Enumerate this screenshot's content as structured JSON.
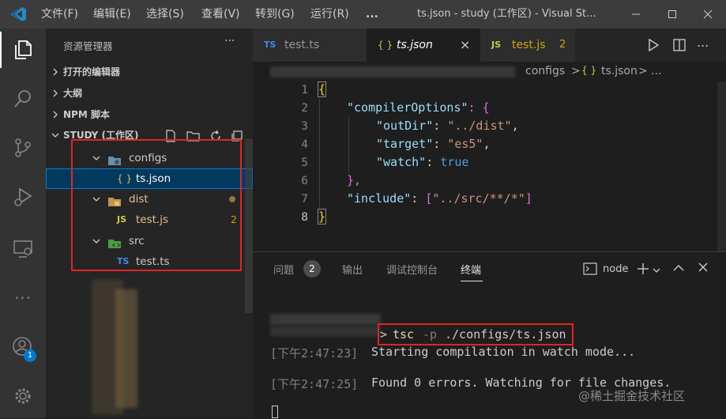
{
  "titlebar": {
    "menus": [
      "文件(F)",
      "编辑(E)",
      "选择(S)",
      "查看(V)",
      "转到(G)",
      "运行(R)"
    ],
    "title": "ts.json - study (工作区) - Visual St...",
    "ellipsis": "..."
  },
  "activity": {
    "icons": [
      "files-icon",
      "search-icon",
      "source-control-icon",
      "run-debug-icon",
      "remote-explorer-icon",
      "more-icon",
      "account-icon",
      "settings-gear-icon"
    ],
    "more": "···",
    "account_badge": "1"
  },
  "sidebar": {
    "header": "资源管理器",
    "header_more": "···",
    "sections": [
      "打开的编辑器",
      "大纲",
      "NPM 脚本",
      "STUDY (工作区)"
    ],
    "tree": [
      {
        "label": "configs",
        "type": "folder"
      },
      {
        "label": "ts.json",
        "type": "file",
        "icon_text": "{ }"
      },
      {
        "label": "dist",
        "type": "folder"
      },
      {
        "label": "test.js",
        "type": "file",
        "icon_text": "JS",
        "badge": "2"
      },
      {
        "label": "src",
        "type": "folder"
      },
      {
        "label": "test.ts",
        "type": "file",
        "icon_text": "TS"
      }
    ]
  },
  "editor": {
    "tabs": [
      {
        "icon": "TS",
        "label": "test.ts"
      },
      {
        "icon": "{ }",
        "label": "ts.json",
        "close": "×"
      },
      {
        "icon": "JS",
        "label": "test.js",
        "badge": "2"
      }
    ],
    "breadcrumb": {
      "folder": "configs",
      "sep": ">",
      "file_icon": "{ }",
      "file": "ts.json",
      "tail": "> ..."
    },
    "code": {
      "line_numbers": [
        "1",
        "2",
        "3",
        "4",
        "5",
        "6",
        "7",
        "8"
      ],
      "l1": "{",
      "l2_key": "\"compilerOptions\"",
      "l2_rest": ": {",
      "l3_key": "\"outDir\"",
      "l3_colon": ": ",
      "l3_val": "\"../dist\"",
      "l3_comma": ",",
      "l4_key": "\"target\"",
      "l4_colon": ": ",
      "l4_val": "\"es5\"",
      "l4_comma": ",",
      "l5_key": "\"watch\"",
      "l5_colon": ": ",
      "l5_val": "true",
      "l6": "},",
      "l7_key": "\"include\"",
      "l7_colon": ": ",
      "l7_open": "[",
      "l7_val": "\"../src/**/*\"",
      "l7_close": "]",
      "l8": "}"
    }
  },
  "panel": {
    "tabs": [
      "问题",
      "输出",
      "调试控制台",
      "终端"
    ],
    "problems_count": "2",
    "terminal_name": "node",
    "terminal": {
      "cmd_prompt": ">",
      "cmd_tsc": "tsc",
      "cmd_flag": "-p",
      "cmd_path": "./configs/ts.json",
      "line1_time": "[下午2:47:23]",
      "line1_msg": "Starting compilation in watch mode...",
      "line2_time": "[下午2:47:25]",
      "line2_msg": "Found 0 errors. Watching for file changes."
    },
    "watermark": "@稀土掘金技术社区"
  },
  "colors": {
    "highlight_box": "#e02424",
    "selection": "#04395e",
    "ts_blue": "#3178c6",
    "js_yellow": "#cbcb41",
    "json_yellow": "#cbcb41"
  }
}
